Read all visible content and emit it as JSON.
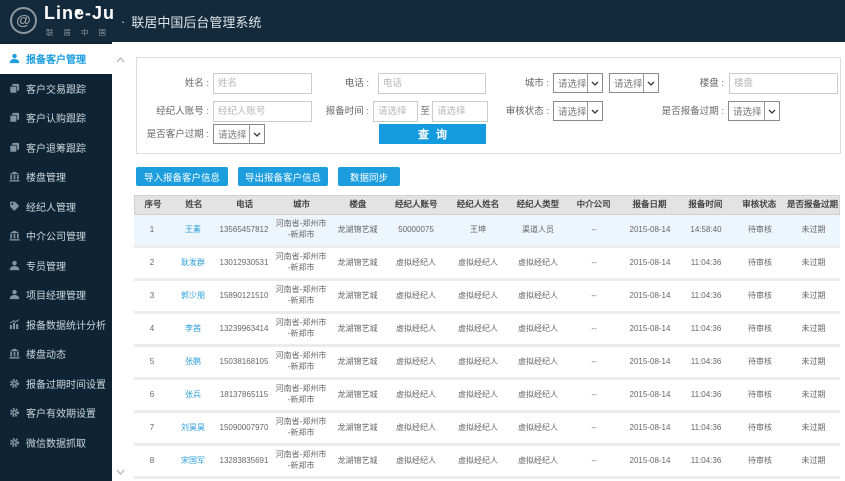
{
  "header": {
    "logo_text": "Line-Ju",
    "logo_sub": "联居中国",
    "logo_at": "@",
    "separator": "·",
    "title": "联居中国后台管理系统"
  },
  "sidebar": {
    "items": [
      {
        "label": "报备客户管理",
        "icon": "user",
        "active": true
      },
      {
        "label": "客户交易跟踪",
        "icon": "stack",
        "active": false
      },
      {
        "label": "客户认购跟踪",
        "icon": "stack",
        "active": false
      },
      {
        "label": "客户退筹跟踪",
        "icon": "stack",
        "active": false
      },
      {
        "label": "楼盘管理",
        "icon": "bank",
        "active": false
      },
      {
        "label": "经纪人管理",
        "icon": "tag",
        "active": false
      },
      {
        "label": "中介公司管理",
        "icon": "bank",
        "active": false
      },
      {
        "label": "专员管理",
        "icon": "user",
        "active": false
      },
      {
        "label": "项目经理管理",
        "icon": "user",
        "active": false
      },
      {
        "label": "报备数据统计分析",
        "icon": "chart",
        "active": false
      },
      {
        "label": "楼盘动态",
        "icon": "bank",
        "active": false
      },
      {
        "label": "报备过期时间设置",
        "icon": "gear",
        "active": false
      },
      {
        "label": "客户有效期设置",
        "icon": "gear",
        "active": false
      },
      {
        "label": "微信数据抓取",
        "icon": "gear",
        "active": false
      }
    ]
  },
  "search": {
    "labels": {
      "name": "姓名 :",
      "phone": "电话 :",
      "city": "城市 :",
      "property": "楼盘 :",
      "agent_account": "经纪人账号 :",
      "report_time": "报备时间 :",
      "to": "至",
      "audit_status": "审核状态 :",
      "report_expired": "是否报备过期 :",
      "customer_expired": "是否客户过期 :"
    },
    "placeholders": {
      "name": "姓名",
      "phone": "电话",
      "property": "楼盘",
      "agent_account": "经纪人账号",
      "select": "请选择"
    },
    "submit": "查询"
  },
  "actions": {
    "import": "导入报备客户信息",
    "export": "导出报备客户信息",
    "sync": "数据同步"
  },
  "table": {
    "columns": [
      "序号",
      "姓名",
      "电话",
      "城市",
      "楼盘",
      "经纪人账号",
      "经纪人姓名",
      "经纪人类型",
      "中介公司",
      "报备日期",
      "报备时间",
      "审核状态",
      "是否报备过期"
    ],
    "rows": [
      {
        "highlighted": true,
        "cells": [
          "1",
          "王素",
          "13565457812",
          "河南省-郑州市\n-新郑市",
          "龙湖锦艺城",
          "50000075",
          "王坤",
          "渠道人员",
          "--",
          "2015-08-14",
          "14:58:40",
          "待审核",
          "未过期"
        ]
      },
      {
        "highlighted": false,
        "cells": [
          "2",
          "耿发群",
          "13012930531",
          "河南省-郑州市\n-新郑市",
          "龙湖锦艺城",
          "虚拟经纪人",
          "虚拟经纪人",
          "虚拟经纪人",
          "--",
          "2015-08-14",
          "11:04:36",
          "待审核",
          "未过期"
        ]
      },
      {
        "highlighted": false,
        "cells": [
          "3",
          "郭少朋",
          "15890121510",
          "河南省-郑州市\n-新郑市",
          "龙湖锦艺城",
          "虚拟经纪人",
          "虚拟经纪人",
          "虚拟经纪人",
          "--",
          "2015-08-14",
          "11:04:36",
          "待审核",
          "未过期"
        ]
      },
      {
        "highlighted": false,
        "cells": [
          "4",
          "李茜",
          "13239963414",
          "河南省-郑州市\n-新郑市",
          "龙湖锦艺城",
          "虚拟经纪人",
          "虚拟经纪人",
          "虚拟经纪人",
          "--",
          "2015-08-14",
          "11:04:36",
          "待审核",
          "未过期"
        ]
      },
      {
        "highlighted": false,
        "cells": [
          "5",
          "张鹏",
          "15038168105",
          "河南省-郑州市\n-新郑市",
          "龙湖锦艺城",
          "虚拟经纪人",
          "虚拟经纪人",
          "虚拟经纪人",
          "--",
          "2015-08-14",
          "11:04:36",
          "待审核",
          "未过期"
        ]
      },
      {
        "highlighted": false,
        "cells": [
          "6",
          "张兵",
          "18137865115",
          "河南省-郑州市\n-新郑市",
          "龙湖锦艺城",
          "虚拟经纪人",
          "虚拟经纪人",
          "虚拟经纪人",
          "--",
          "2015-08-14",
          "11:04:36",
          "待审核",
          "未过期"
        ]
      },
      {
        "highlighted": false,
        "cells": [
          "7",
          "刘昊昊",
          "15090007970",
          "河南省-郑州市\n-新郑市",
          "龙湖锦艺城",
          "虚拟经纪人",
          "虚拟经纪人",
          "虚拟经纪人",
          "--",
          "2015-08-14",
          "11:04:36",
          "待审核",
          "未过期"
        ]
      },
      {
        "highlighted": false,
        "cells": [
          "8",
          "宋国军",
          "13283835691",
          "河南省-郑州市\n-新郑市",
          "龙湖锦艺城",
          "虚拟经纪人",
          "虚拟经纪人",
          "虚拟经纪人",
          "--",
          "2015-08-14",
          "11:04:36",
          "待审核",
          "未过期"
        ]
      }
    ]
  },
  "colors": {
    "header_bg": "#13293c",
    "sidebar_bg": "#0e2435",
    "accent_blue": "#1b9dde",
    "highlight_row": "#edf6fd",
    "table_header_bg": "#e3e3e3"
  }
}
